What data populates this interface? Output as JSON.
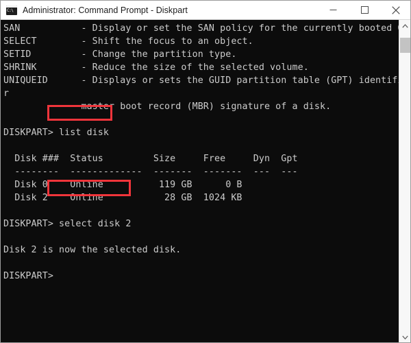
{
  "window": {
    "title": "Administrator: Command Prompt - Diskpart",
    "icon": "console-icon",
    "controls": {
      "minimize": "minimize-icon",
      "maximize": "maximize-icon",
      "close": "close-icon"
    }
  },
  "terminal": {
    "background_color": "#0c0c0c",
    "text_color": "#cccccc",
    "content": "SAN           - Display or set the SAN policy for the currently booted OS.\nSELECT        - Shift the focus to an object.\nSETID         - Change the partition type.\nSHRINK        - Reduce the size of the selected volume.\nUNIQUEID      - Displays or sets the GUID partition table (GPT) identifier o\nr\n              master boot record (MBR) signature of a disk.\n\nDISKPART> list disk\n\n  Disk ###  Status         Size     Free     Dyn  Gpt\n  --------  -------------  -------  -------  ---  ---\n  Disk 0    Online          119 GB      0 B\n  Disk 2    Online           28 GB  1024 KB\n\nDISKPART> select disk 2\n\nDisk 2 is now the selected disk.\n\nDISKPART>"
  },
  "commands": {
    "list_disk": "list disk",
    "select_disk": "select disk 2",
    "prompt": "DISKPART>",
    "confirmation": "Disk 2 is now the selected disk."
  },
  "disk_table": {
    "columns": [
      "Disk ###",
      "Status",
      "Size",
      "Free",
      "Dyn",
      "Gpt"
    ],
    "rows": [
      {
        "disk": "Disk 0",
        "status": "Online",
        "size": "119 GB",
        "free": "0 B",
        "dyn": "",
        "gpt": ""
      },
      {
        "disk": "Disk 2",
        "status": "Online",
        "size": "28 GB",
        "free": "1024 KB",
        "dyn": "",
        "gpt": ""
      }
    ]
  },
  "help_entries": [
    {
      "command": "SAN",
      "description": "Display or set the SAN policy for the currently booted OS."
    },
    {
      "command": "SELECT",
      "description": "Shift the focus to an object."
    },
    {
      "command": "SETID",
      "description": "Change the partition type."
    },
    {
      "command": "SHRINK",
      "description": "Reduce the size of the selected volume."
    },
    {
      "command": "UNIQUEID",
      "description": "Displays or sets the GUID partition table (GPT) identifier or master boot record (MBR) signature of a disk."
    }
  ],
  "annotations": {
    "color": "#f0353b",
    "boxes": [
      "list disk",
      "select disk 2"
    ]
  },
  "scrollbar": {
    "up_arrow": "chevron-up-icon",
    "down_arrow": "chevron-down-icon"
  }
}
